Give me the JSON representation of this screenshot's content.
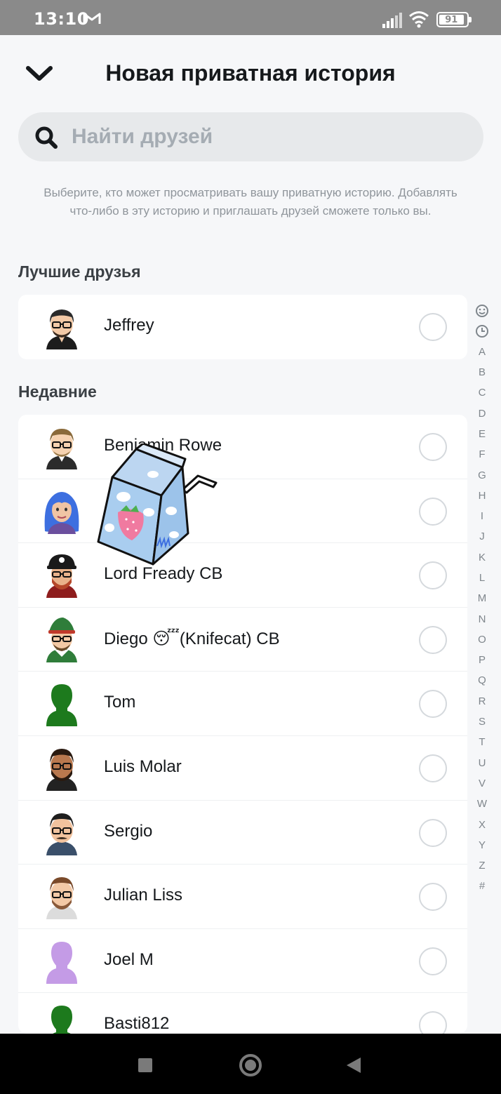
{
  "status_bar": {
    "time": "13:10",
    "battery": "91",
    "battery_percent": 91,
    "icons": [
      "mail-icon",
      "signal-icon",
      "wifi-icon",
      "battery-icon"
    ]
  },
  "header": {
    "title": "Новая приватная история",
    "back_icon": "chevron-down-icon"
  },
  "search": {
    "placeholder": "Найти друзей",
    "value": "",
    "icon": "search-icon"
  },
  "description": "Выберите, кто может просматривать вашу приватную историю. Добавлять что-либо в эту историю и приглашать друзей сможете только вы.",
  "best_friends": {
    "title": "Лучшие друзья",
    "items": [
      {
        "name": "Jeffrey",
        "avatar": "bitmoji-avatar",
        "selected": false
      }
    ]
  },
  "recent": {
    "title": "Недавние",
    "items": [
      {
        "name": "Benjamin Rowe",
        "avatar": "bitmoji-avatar",
        "selected": false
      },
      {
        "name": "",
        "avatar": "bitmoji-avatar",
        "selected": false
      },
      {
        "name": "Lord Fready CB",
        "avatar": "bitmoji-avatar",
        "selected": false
      },
      {
        "name": "Diego 😴(Knifecat) CB",
        "avatar": "bitmoji-avatar",
        "selected": false
      },
      {
        "name": "Tom",
        "avatar": "silhouette-avatar",
        "selected": false
      },
      {
        "name": "Luis Molar",
        "avatar": "bitmoji-avatar",
        "selected": false
      },
      {
        "name": "Sergio",
        "avatar": "bitmoji-avatar",
        "selected": false
      },
      {
        "name": "Julian Liss",
        "avatar": "bitmoji-avatar",
        "selected": false
      },
      {
        "name": "Joel M",
        "avatar": "silhouette-avatar",
        "selected": false
      },
      {
        "name": "Basti812",
        "avatar": "silhouette-avatar",
        "selected": false
      }
    ]
  },
  "alphabet_index": [
    "smiley-icon",
    "clock-icon",
    "A",
    "B",
    "C",
    "D",
    "E",
    "F",
    "G",
    "H",
    "I",
    "J",
    "K",
    "L",
    "M",
    "N",
    "O",
    "P",
    "Q",
    "R",
    "S",
    "T",
    "U",
    "V",
    "W",
    "X",
    "Y",
    "Z",
    "#"
  ],
  "sticker": "milk-carton-sticker",
  "nav_bar": [
    "square-icon",
    "circle-icon",
    "triangle-back-icon"
  ],
  "colors": {
    "background": "#f6f7f9",
    "card": "#ffffff",
    "status_bar": "#8a8a8a",
    "search_bg": "#e7e9eb",
    "silhouette_green": "#1d7a1d",
    "silhouette_purple": "#c49be6"
  }
}
